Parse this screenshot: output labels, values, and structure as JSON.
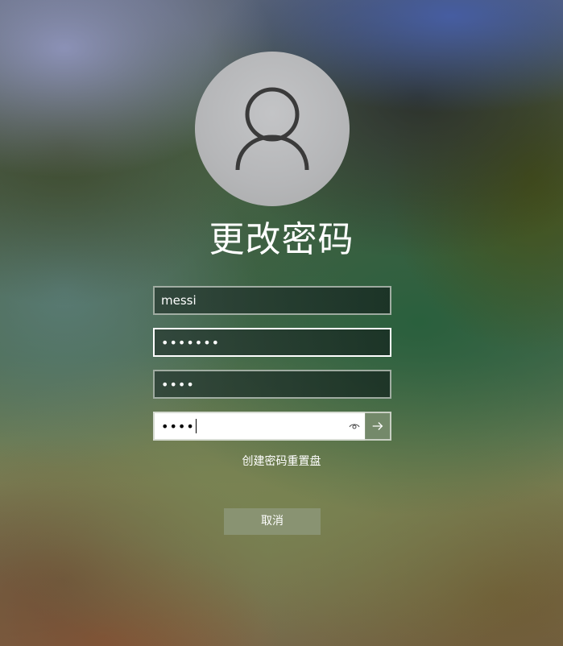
{
  "title": "更改密码",
  "fields": {
    "username": {
      "value": "messi"
    },
    "old_password": {
      "value": "•••••••"
    },
    "new_password": {
      "value": "••••"
    },
    "confirm_password": {
      "value": "••••"
    }
  },
  "icons": {
    "avatar": "user-icon",
    "reveal": "eye-icon",
    "submit": "arrow-right-icon"
  },
  "link_text": "创建密码重置盘",
  "cancel_label": "取消"
}
